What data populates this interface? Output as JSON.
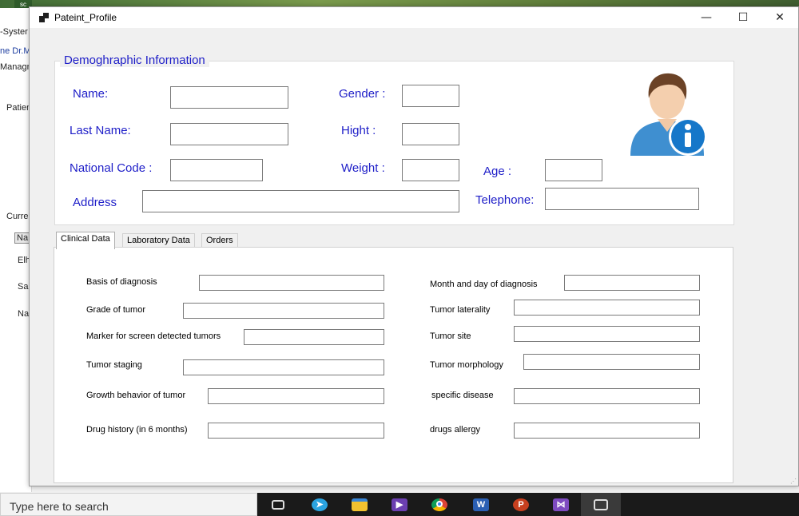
{
  "background_app": {
    "texts": [
      "-Syster",
      "ne Dr.M",
      "Managn",
      "Patien",
      "Curre",
      "Na",
      "Elh",
      "Sar",
      "Na"
    ],
    "icon_text": "sc"
  },
  "window": {
    "title": "Pateint_Profile",
    "minimize_glyph": "—",
    "maximize_glyph": "☐",
    "close_glyph": "✕"
  },
  "demographic": {
    "group_title": "Demoghraphic Information",
    "name_label": "Name:",
    "last_name_label": "Last Name:",
    "national_code_label": "National Code :",
    "address_label": "Address",
    "gender_label": "Gender :",
    "hight_label": "Hight :",
    "weight_label": "Weight :",
    "age_label": "Age :",
    "telephone_label": "Telephone:"
  },
  "tabs": [
    {
      "label": "Clinical Data",
      "active": true
    },
    {
      "label": "Laboratory Data",
      "active": false
    },
    {
      "label": "Orders",
      "active": false
    }
  ],
  "clinical": {
    "basis_of_diagnosis": "Basis of diagnosis",
    "grade_of_tumor": "Grade of tumor",
    "marker_for_screen": "Marker for screen detected tumors",
    "tumor_staging": "Tumor staging",
    "growth_behavior": "Growth behavior of tumor",
    "drug_history": "Drug history (in 6 months)",
    "month_day_diagnosis": "Month and day of diagnosis",
    "tumor_laterality": "Tumor laterality",
    "tumor_site": "Tumor site",
    "tumor_morphology": "Tumor morphology",
    "specific_disease": "specific disease",
    "drugs_allergy": "drugs allergy"
  },
  "taskbar": {
    "search_placeholder": "Type here to search",
    "icons": [
      "task-view-icon",
      "telegram-icon",
      "file-explorer-icon",
      "media-player-icon",
      "chrome-icon",
      "word-icon",
      "powerpoint-icon",
      "visual-studio-icon",
      "window-switch-icon"
    ]
  },
  "colors": {
    "label_blue": "#1e1ec8",
    "window_bg": "#f0f0f0",
    "taskbar": "#1a1a1a"
  }
}
